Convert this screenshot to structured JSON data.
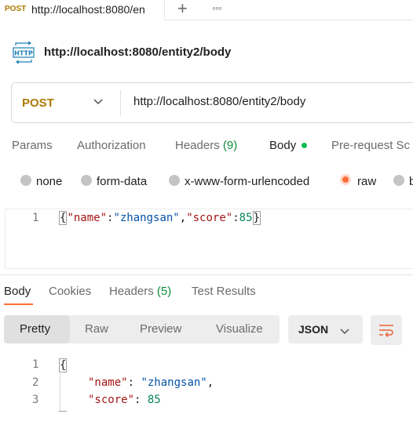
{
  "tab": {
    "method": "POST",
    "url": "http://localhost:8080/en"
  },
  "request": {
    "title": "http://localhost:8080/entity2/body",
    "method": "POST",
    "url": "http://localhost:8080/entity2/body",
    "tabs": {
      "params": "Params",
      "authorization": "Authorization",
      "headers": "Headers",
      "headers_count": "(9)",
      "body": "Body",
      "prerequest": "Pre-request Sc"
    },
    "body_types": [
      "none",
      "form-data",
      "x-www-form-urlencoded",
      "raw",
      "b"
    ],
    "selected_body_type": "raw",
    "body_line_number": "1",
    "body_json": {
      "open": "{",
      "k1": "\"name\"",
      "c1": ":",
      "v1": "\"zhangsan\"",
      "comma": ",",
      "k2": "\"score\"",
      "c2": ":",
      "v2": "85",
      "close": "}"
    }
  },
  "response": {
    "tabs": {
      "body": "Body",
      "cookies": "Cookies",
      "headers": "Headers",
      "headers_count": "(5)",
      "test_results": "Test Results"
    },
    "view_modes": [
      "Pretty",
      "Raw",
      "Preview",
      "Visualize"
    ],
    "selected_view": "Pretty",
    "format": "JSON",
    "lines": {
      "n1": "1",
      "n2": "2",
      "n3": "3",
      "l1": "{",
      "k_name": "\"name\"",
      "v_name": "\"zhangsan\"",
      "k_score": "\"score\"",
      "v_score": "85",
      "colon": ": ",
      "comma": ","
    }
  },
  "colors": {
    "accent": "#ff6c37",
    "method": "#ad7a03",
    "green": "#0cbb52"
  },
  "icons": [
    "http-icon",
    "plus-icon",
    "more-icon",
    "chevron-down-icon",
    "wrap-lines-icon"
  ]
}
